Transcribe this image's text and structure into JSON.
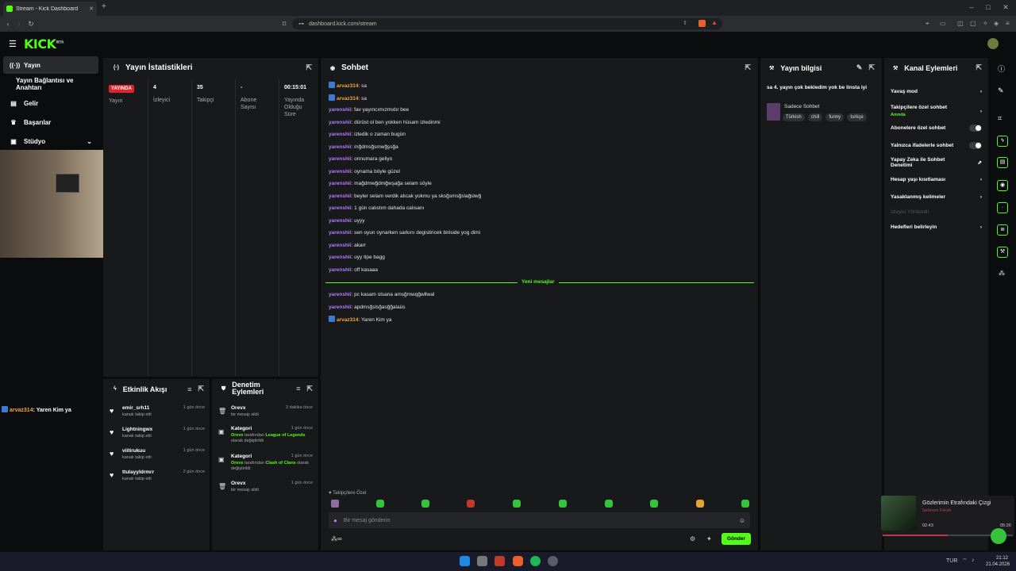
{
  "browser": {
    "tab_title": "Stream - Kick Dashboard",
    "url": "dashboard.kick.com/stream"
  },
  "header": {
    "logo": "KICK",
    "logo_tag": "BETA"
  },
  "sidebar": {
    "items": [
      {
        "label": "Yayın",
        "icon": "broadcast-icon"
      },
      {
        "label": "Yayın Bağlantısı ve Anahtarı",
        "icon": ""
      },
      {
        "label": "Gelir",
        "icon": "revenue-icon"
      },
      {
        "label": "Başarılar",
        "icon": "trophy-icon"
      },
      {
        "label": "Stüdyo",
        "icon": "studio-icon"
      }
    ],
    "last_chat": {
      "user": "arvaz314",
      "text": ": Yaren Kim ya"
    }
  },
  "stats": {
    "title": "Yayın İstatistikleri",
    "cells": [
      {
        "value": "YAYINDA",
        "label": "Yayın"
      },
      {
        "value": "4",
        "label": "İzleyici"
      },
      {
        "value": "35",
        "label": "Takipçi"
      },
      {
        "value": "-",
        "label": "Abone Sayısı"
      },
      {
        "value": "00:15:01",
        "label": "Yayında Olduğu Süre"
      }
    ]
  },
  "chat": {
    "title": "Sohbet",
    "messages": [
      {
        "user": "arvaz314",
        "text": ": sa",
        "badge": true
      },
      {
        "user": "arvaz314",
        "text": ": sa",
        "badge": true
      },
      {
        "user": "yarenshii",
        "text": ": fav yayıncımızmıdır bee"
      },
      {
        "user": "yarenshii",
        "text": ": dürüst ol ben yokken hüsam izledinmi"
      },
      {
        "user": "yarenshii",
        "text": ": izledik o zaman bugün"
      },
      {
        "user": "yarenshii",
        "text": ": mğdmsğsmwğşsğa"
      },
      {
        "user": "yarenshii",
        "text": ": onnumara geliyo"
      },
      {
        "user": "yarenshii",
        "text": ": oynama böyle güzel"
      },
      {
        "user": "yarenshii",
        "text": ": mağdmwğdmğwşağa selam söyle"
      },
      {
        "user": "yarenshii",
        "text": ": beyler selam verdik alıcak yokmu ya sksğsmsğslağslwğ"
      },
      {
        "user": "yarenshii",
        "text": ": 1 gün calıstım dahada calısanı"
      },
      {
        "user": "yarenshii",
        "text": ": uyyy"
      },
      {
        "user": "yarenshii",
        "text": ": sen oyun oynarken sarkını degistiricek biriside yog dimi"
      },
      {
        "user": "yarenshii",
        "text": ": akarr"
      },
      {
        "user": "yarenshii",
        "text": ": uyy tipe bagg"
      },
      {
        "user": "yarenshii",
        "text": ": off kasaaa"
      }
    ],
    "new_divider": "Yeni mesajlar",
    "new_messages": [
      {
        "user": "yarenshii",
        "text": ": pc kasam olsana amsğmwqğwllwal"
      },
      {
        "user": "yarenshii",
        "text": ": apdmsğslsğasğğalaüs"
      },
      {
        "user": "arvaz314",
        "text": ": Yaren Kim ya",
        "badge": true
      }
    ],
    "followers_only": "Takipçilere Özel",
    "input_placeholder": "Bir mesaj gönderin",
    "send_label": "Gönder"
  },
  "stream_info": {
    "title": "Yayın bilgisi",
    "stream_title": "sa 4. yayın çok bekledim yok be linsta iyi",
    "category": "Sadece Sohbet",
    "tags": [
      "Türkish",
      "chill",
      "funny",
      "turkçe"
    ]
  },
  "channel_actions": {
    "title": "Kanal Eylemleri",
    "items": [
      {
        "label": "Yavaş mod",
        "control": "chevron"
      },
      {
        "label": "Takipçilere özel sohbet",
        "sub": "Anında",
        "control": "chevron"
      },
      {
        "label": "Abonelere özel sohbet",
        "control": "toggle"
      },
      {
        "label": "Yalnızca ifadelerle sohbet",
        "control": "toggle"
      },
      {
        "label": "Yapay Zeka ile Sohbet Denetimi",
        "control": "external"
      },
      {
        "label": "Hesap yaşı kısıtlaması",
        "control": "chevron"
      },
      {
        "label": "Yasaklanmış kelimeler",
        "control": "chevron"
      },
      {
        "label": "İzleyici Yönlendir",
        "control": "none",
        "disabled": true
      },
      {
        "label": "Hedefleri belirleyin",
        "control": "chevron"
      }
    ]
  },
  "activity": {
    "title": "Etkinlik Akışı",
    "items": [
      {
        "name": "emir_srh11",
        "sub": "kanalı takip etti",
        "time": "1 gün önce"
      },
      {
        "name": "Lightningwx",
        "sub": "kanalı takip etti",
        "time": "1 gün önce"
      },
      {
        "name": "viitirukuu",
        "sub": "kanalı takip etti",
        "time": "1 gün önce"
      },
      {
        "name": "ttulayyldrmrr",
        "sub": "kanalı takip etti",
        "time": "2 gün önce"
      }
    ]
  },
  "moderation": {
    "title": "Denetim Eylemleri",
    "items": [
      {
        "name": "Orevx",
        "sub": "bir mesajı sildi",
        "time": "3 dakika önce"
      },
      {
        "name": "Kategori",
        "who": "Orevx",
        "mid": " tarafından ",
        "what": "League of Legends",
        "end": " olarak değiştirildi",
        "time": "1 gün önce"
      },
      {
        "name": "Kategori",
        "who": "Orevx",
        "mid": " tarafından ",
        "what": "Clash of Clans",
        "end": " olarak değiştirildi",
        "time": "1 gün önce"
      },
      {
        "name": "Orevx",
        "sub": "bir mesajı sildi",
        "time": "1 gün önce"
      }
    ]
  },
  "media": {
    "title": "Gözlerimin Etrafındaki Çizgi",
    "artist": "Şebnem Ferah",
    "elapsed": "02:43",
    "total": "05:26",
    "progress": 0.5
  },
  "taskbar": {
    "lang": "TUR",
    "time": "21:12",
    "date": "21.04.2026"
  }
}
